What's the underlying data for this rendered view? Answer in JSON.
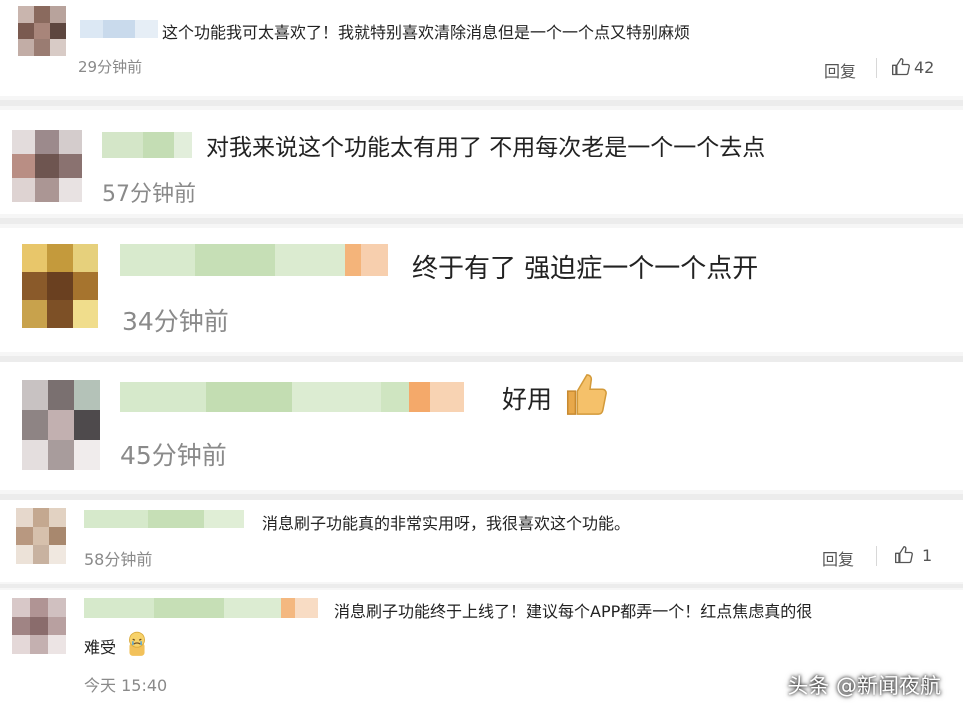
{
  "comments": [
    {
      "text": "这个功能我可太喜欢了！我就特别喜欢清除消息但是一个一个点又特别麻烦",
      "time": "29分钟前",
      "reply_label": "回复",
      "like_count": "42"
    },
    {
      "text": "对我来说这个功能太有用了 不用每次老是一个一个去点",
      "time": "57分钟前"
    },
    {
      "text": "终于有了 强迫症一个一个点开",
      "time": "34分钟前"
    },
    {
      "text": "好用",
      "emoji": "thumbs-up",
      "time": "45分钟前"
    },
    {
      "text": "消息刷子功能真的非常实用呀，我很喜欢这个功能。",
      "time": "58分钟前",
      "reply_label": "回复",
      "like_count": "1"
    },
    {
      "text_line1": "消息刷子功能终于上线了！建议每个APP都弄一个！红点焦虑真的很",
      "text_line2": "难受",
      "emoji": "crying-face",
      "time": "今天 15:40"
    }
  ],
  "watermark": "头条 @新闻夜航",
  "colors": {
    "background": "#f6f6f6",
    "card": "#ffffff",
    "meta_text": "#8a8a8a",
    "body_text": "#222222"
  }
}
